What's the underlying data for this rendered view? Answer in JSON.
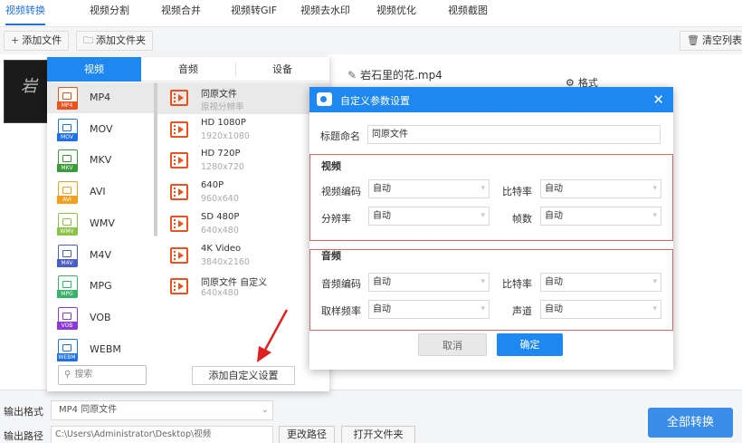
{
  "top_tabs": [
    "视频转换",
    "视频分割",
    "视频合并",
    "视频转GIF",
    "视频去水印",
    "视频优化",
    "视频截图"
  ],
  "toolbar": {
    "add_file": "添加文件",
    "add_folder": "添加文件夹",
    "clear_list": "清空列表"
  },
  "file": {
    "name": "岩石里的花.mp4",
    "format_label": "格式",
    "thumb_text": "岩"
  },
  "popup": {
    "tabs": [
      "视频",
      "音频",
      "设备"
    ],
    "formats": [
      {
        "label": "MP4",
        "tag": "MP4",
        "color": "#e8531f"
      },
      {
        "label": "MOV",
        "tag": "MOV",
        "color": "#1e72e6"
      },
      {
        "label": "MKV",
        "tag": "MKV",
        "color": "#3a9b3a"
      },
      {
        "label": "AVI",
        "tag": "AVI",
        "color": "#f0a020"
      },
      {
        "label": "WMV",
        "tag": "WMV",
        "color": "#8bc34a"
      },
      {
        "label": "M4V",
        "tag": "M4V",
        "color": "#4a5fc1"
      },
      {
        "label": "MPG",
        "tag": "MPG",
        "color": "#3ab36a"
      },
      {
        "label": "VOB",
        "tag": "VOB",
        "color": "#8b3ad6"
      },
      {
        "label": "WEBM",
        "tag": "WEBM",
        "color": "#1e72e6"
      }
    ],
    "resolutions": [
      {
        "name": "同原文件",
        "sub": "原视分辨率"
      },
      {
        "name": "HD 1080P",
        "sub": "1920x1080"
      },
      {
        "name": "HD 720P",
        "sub": "1280x720"
      },
      {
        "name": "640P",
        "sub": "960x640"
      },
      {
        "name": "SD 480P",
        "sub": "640x480"
      },
      {
        "name": "4K Video",
        "sub": "3840x2160"
      },
      {
        "name": "同原文件 自定义",
        "sub": "640x480"
      }
    ],
    "search_placeholder": "搜索",
    "add_custom": "添加自定义设置"
  },
  "dialog": {
    "title": "自定义参数设置",
    "title_label": "标题命名",
    "title_value": "同原文件",
    "video_group": "视频",
    "audio_group": "音频",
    "video_codec_label": "视频编码",
    "video_codec_value": "自动",
    "bitrate_label": "比特率",
    "bitrate_value": "自动",
    "resolution_label": "分辨率",
    "resolution_value": "自动",
    "fps_label": "帧数",
    "fps_value": "自动",
    "audio_codec_label": "音频编码",
    "audio_codec_value": "自动",
    "audio_bitrate_label": "比特率",
    "audio_bitrate_value": "自动",
    "sample_rate_label": "取样频率",
    "sample_rate_value": "自动",
    "channel_label": "声道",
    "channel_value": "自动",
    "cancel": "取消",
    "confirm": "确定"
  },
  "bottom": {
    "format_label": "输出格式",
    "format_value": "MP4 同原文件",
    "path_label": "输出路径",
    "path_value": "C:\\Users\\Administrator\\Desktop\\视频",
    "change_path": "更改路径",
    "open_folder": "打开文件夹",
    "convert_all": "全部转换"
  },
  "colors": {
    "accent": "#1e87f0",
    "tab_active": "#1e72e6",
    "group_border": "#e06666",
    "arrow": "#e02020",
    "film": "#e8531f"
  }
}
